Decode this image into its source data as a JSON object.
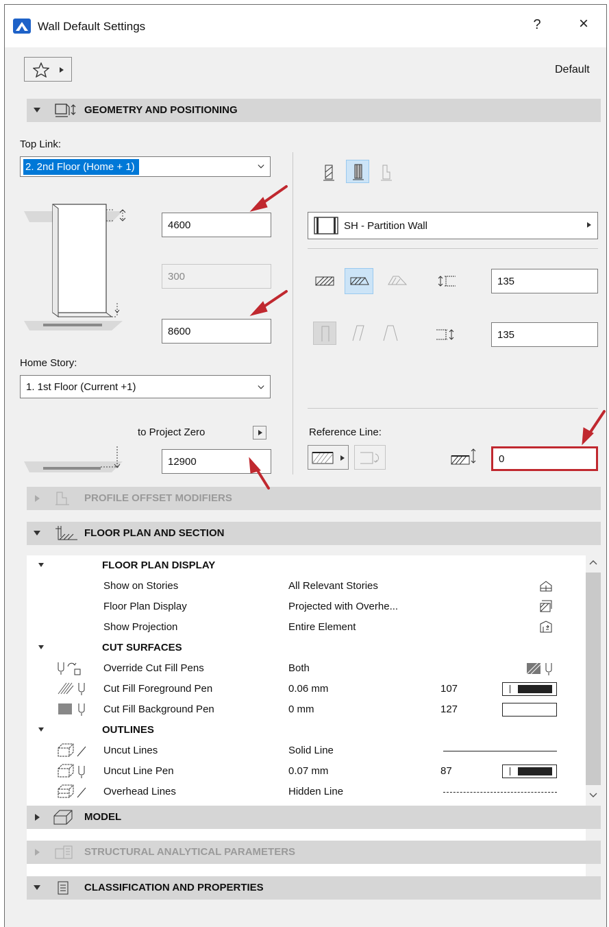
{
  "window": {
    "title": "Wall Default Settings",
    "help_label": "?",
    "close_label": "×"
  },
  "toolbar": {
    "favorites_icon": "star-icon",
    "default_label": "Default"
  },
  "sections": {
    "geometry": "GEOMETRY AND POSITIONING",
    "profile": "PROFILE OFFSET MODIFIERS",
    "floorplan": "FLOOR PLAN AND SECTION",
    "model": "MODEL",
    "structural": "STRUCTURAL ANALYTICAL PARAMETERS",
    "classification": "CLASSIFICATION AND PROPERTIES"
  },
  "geometry": {
    "top_link_label": "Top Link:",
    "top_link_value": "2. 2nd Floor (Home + 1)",
    "height_value": "4600",
    "offset_value": "300",
    "bottom_value": "8600",
    "home_story_label": "Home Story:",
    "home_story_value": "1. 1st Floor (Current +1)",
    "to_project_zero_label": "to Project Zero",
    "project_zero_value": "12900",
    "composite_value": "SH - Partition Wall",
    "thickness_top_value": "135",
    "thickness_bottom_value": "135",
    "reference_line_label": "Reference Line:",
    "ref_offset_value": "0"
  },
  "table": {
    "groups": [
      {
        "title": "FLOOR PLAN DISPLAY",
        "rows": [
          {
            "name": "Show on Stories",
            "value": "All Relevant Stories",
            "num": "",
            "icon": "stories-icon"
          },
          {
            "name": "Floor Plan Display",
            "value": "Projected with Overhe...",
            "num": "",
            "icon": "display-icon"
          },
          {
            "name": "Show Projection",
            "value": "Entire Element",
            "num": "",
            "icon": "projection-icon"
          }
        ]
      },
      {
        "title": "CUT SURFACES",
        "rows": [
          {
            "name": "Override Cut Fill Pens",
            "value": "Both",
            "num": "",
            "icon": "pen-override-icon"
          },
          {
            "name": "Cut Fill Foreground Pen",
            "value": "0.06 mm",
            "num": "107",
            "icon": "foreground-pen-icon"
          },
          {
            "name": "Cut Fill Background Pen",
            "value": "0 mm",
            "num": "127",
            "icon": "background-pen-icon"
          }
        ]
      },
      {
        "title": "OUTLINES",
        "rows": [
          {
            "name": "Uncut Lines",
            "value": "Solid Line",
            "num": "",
            "icon": "uncut-lines-icon"
          },
          {
            "name": "Uncut Line Pen",
            "value": "0.07 mm",
            "num": "87",
            "icon": "uncut-pen-icon"
          },
          {
            "name": "Overhead Lines",
            "value": "Hidden Line",
            "num": "",
            "icon": "overhead-lines-icon"
          }
        ]
      }
    ]
  },
  "colors": {
    "accent": "#0078d7",
    "highlight_box": "#c0282f",
    "arrow": "#c0282f",
    "section_bg": "#d6d6d6"
  }
}
